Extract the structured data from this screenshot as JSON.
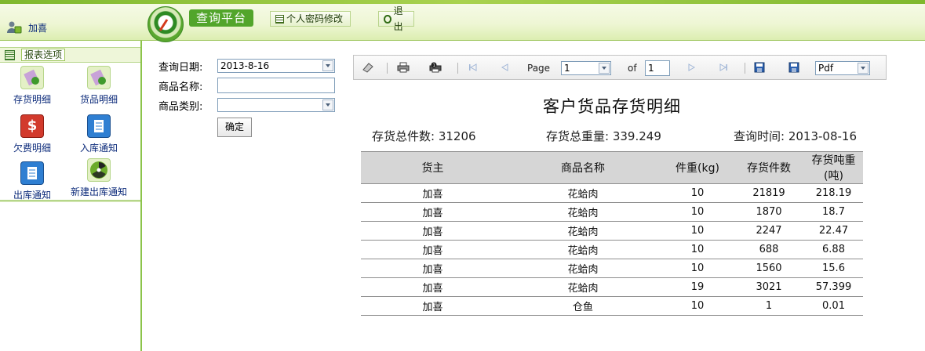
{
  "header": {
    "user_name": "加喜",
    "platform_title": "查询平台",
    "change_password_label": "个人密码修改",
    "logout_label": "退出"
  },
  "sidebar": {
    "section_label": "报表选项",
    "items": [
      {
        "label": "存货明细",
        "icon": "inventory-detail-icon"
      },
      {
        "label": "货品明细",
        "icon": "goods-detail-icon"
      },
      {
        "label": "欠费明细",
        "icon": "dollar-icon"
      },
      {
        "label": "入库通知",
        "icon": "document-icon"
      },
      {
        "label": "出库通知",
        "icon": "document-icon"
      },
      {
        "label": "新建出库通知",
        "icon": "radiation-icon"
      }
    ]
  },
  "form": {
    "date_label": "查询日期:",
    "date_value": "2013-8-16",
    "product_name_label": "商品名称:",
    "product_name_value": "",
    "category_label": "商品类别:",
    "category_value": "",
    "submit_label": "确定"
  },
  "toolbar": {
    "page_label": "Page",
    "page_value": "1",
    "of_label": "of",
    "total_pages": "1",
    "export_format": "Pdf"
  },
  "report": {
    "title": "客户货品存货明细",
    "total_count_label": "存货总件数:",
    "total_count_value": "31206",
    "total_weight_label": "存货总重量:",
    "total_weight_value": "339.249",
    "query_time_label": "查询时间:",
    "query_time_value": "2013-08-16",
    "columns": [
      "货主",
      "商品名称",
      "件重(kg)",
      "存货件数",
      "存货吨重(吨)"
    ],
    "rows": [
      [
        "加喜",
        "花蛤肉",
        "10",
        "21819",
        "218.19"
      ],
      [
        "加喜",
        "花蛤肉",
        "10",
        "1870",
        "18.7"
      ],
      [
        "加喜",
        "花蛤肉",
        "10",
        "2247",
        "22.47"
      ],
      [
        "加喜",
        "花蛤肉",
        "10",
        "688",
        "6.88"
      ],
      [
        "加喜",
        "花蛤肉",
        "10",
        "1560",
        "15.6"
      ],
      [
        "加喜",
        "花蛤肉",
        "19",
        "3021",
        "57.399"
      ],
      [
        "加喜",
        "仓鱼",
        "10",
        "1",
        "0.01"
      ]
    ]
  },
  "colors": {
    "accent_green": "#52a52b",
    "sidebar_border": "#8cc44a",
    "link_blue": "#0b2a7a"
  }
}
